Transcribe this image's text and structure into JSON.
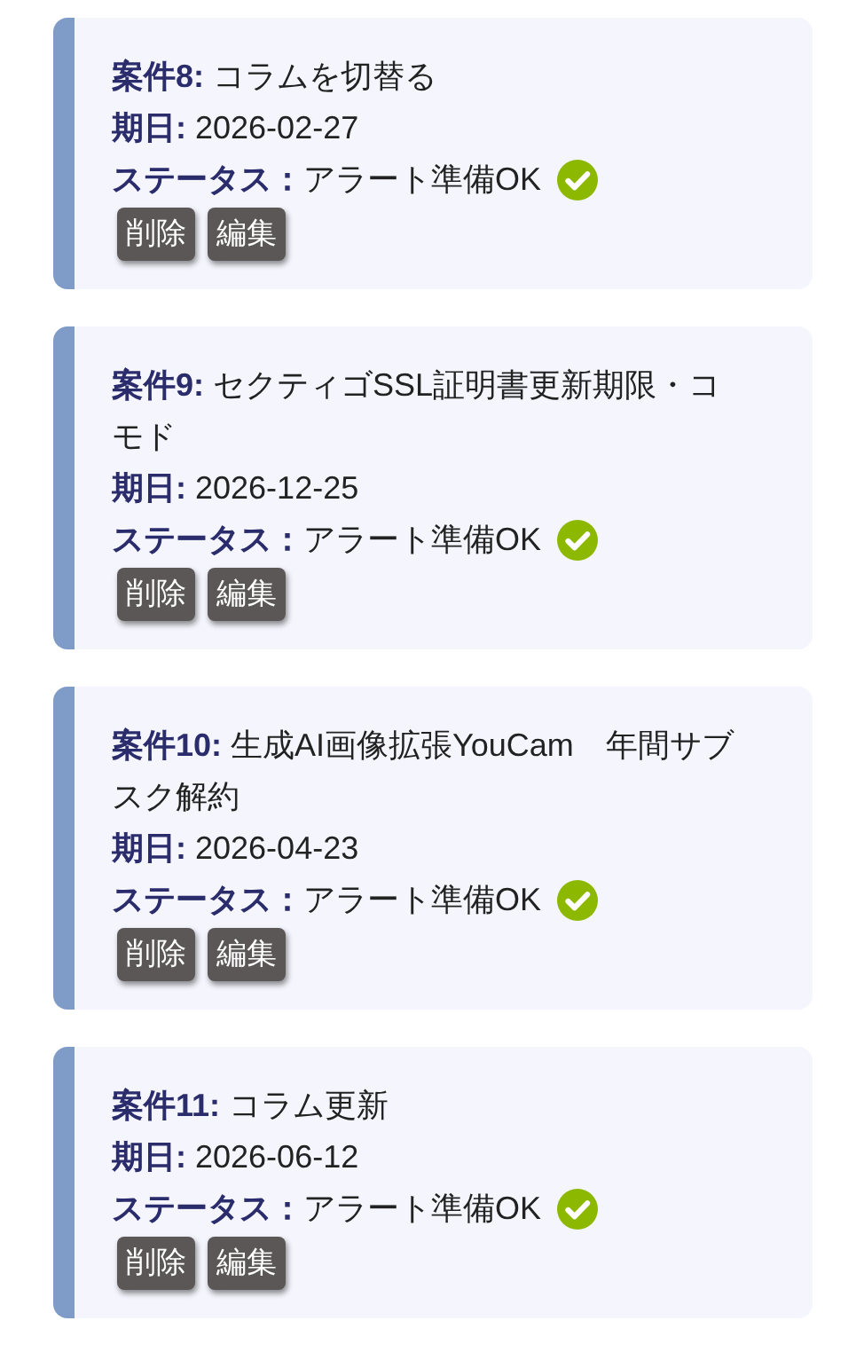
{
  "cases": [
    {
      "label": "案件8:",
      "title": "コラムを切替る",
      "date_label": "期日:",
      "date": "2026-02-27",
      "status_label": "ステータス：",
      "status": "アラート準備OK",
      "status_ok": true,
      "buttons": [
        "削除",
        "編集"
      ]
    },
    {
      "label": "案件9:",
      "title": "セクティゴSSL証明書更新期限・コモド",
      "date_label": "期日:",
      "date": "2026-12-25",
      "status_label": "ステータス：",
      "status": "アラート準備OK",
      "status_ok": true,
      "buttons": [
        "削除",
        "編集"
      ]
    },
    {
      "label": "案件10:",
      "title": "生成AI画像拡張YouCam　年間サブスク解約",
      "date_label": "期日:",
      "date": "2026-04-23",
      "status_label": "ステータス：",
      "status": "アラート準備OK",
      "status_ok": true,
      "buttons": [
        "削除",
        "編集"
      ]
    },
    {
      "label": "案件11:",
      "title": "コラム更新",
      "date_label": "期日:",
      "date": "2026-06-12",
      "status_label": "ステータス：",
      "status": "アラート準備OK",
      "status_ok": true,
      "buttons": [
        "削除",
        "編集"
      ]
    }
  ]
}
